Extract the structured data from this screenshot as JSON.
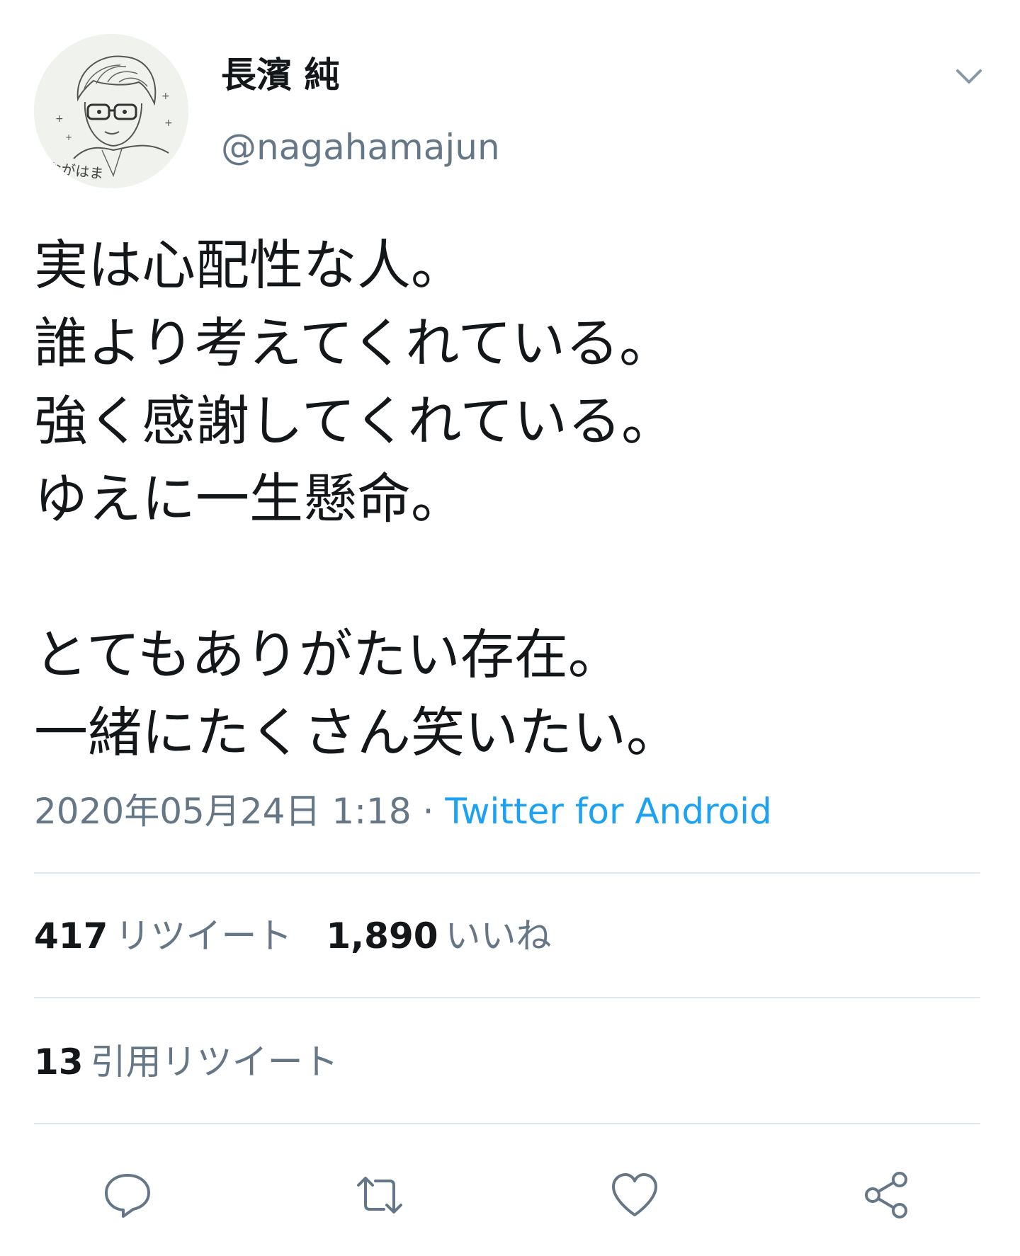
{
  "author": {
    "display_name": "長濱 純",
    "handle": "@nagahamajun",
    "avatar_caption": "ながはま"
  },
  "tweet": {
    "lines": [
      "実は心配性な人。",
      "誰より考えてくれている。",
      "強く感謝してくれている。",
      "ゆえに一生懸命。",
      "",
      "とてもありがたい存在。",
      "一緒にたくさん笑いたい。"
    ],
    "timestamp": "2020年05月24日 1:18",
    "separator": " · ",
    "source": "Twitter for Android"
  },
  "stats": {
    "retweets_count": "417",
    "retweets_label": "リツイート",
    "likes_count": "1,890",
    "likes_label": "いいね",
    "quotes_count": "13",
    "quotes_label": "引用リツイート"
  },
  "icons": {
    "menu": "chevron-down-icon",
    "reply": "reply-icon",
    "retweet": "retweet-icon",
    "like": "heart-icon",
    "share": "share-icon"
  },
  "colors": {
    "text": "#14171a",
    "secondary": "#657786",
    "link": "#1da1f2",
    "divider": "#e1e8ed"
  }
}
